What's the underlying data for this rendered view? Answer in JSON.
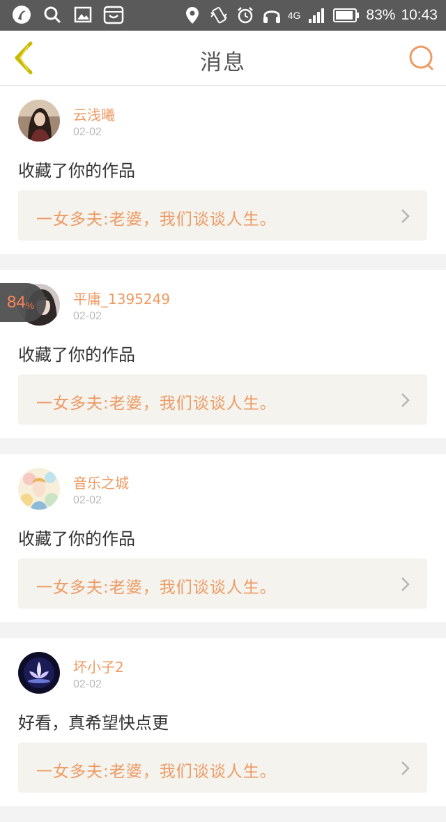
{
  "status_bar": {
    "network": "4G",
    "battery_percent": "83%",
    "time": "10:43"
  },
  "header": {
    "title": "消息"
  },
  "messages": [
    {
      "username": "云浅曦",
      "date": "02-02",
      "text": "收藏了你的作品",
      "work_title": "一女多夫:老婆，我们谈谈人生。",
      "avatar": "avatar-woman-photo"
    },
    {
      "username": "平庸_1395249",
      "date": "02-02",
      "text": "收藏了你的作品",
      "work_title": "一女多夫:老婆，我们谈谈人生。",
      "avatar": "avatar-face-photo"
    },
    {
      "username": "音乐之城",
      "date": "02-02",
      "text": "收藏了你的作品",
      "work_title": "一女多夫:老婆，我们谈谈人生。",
      "avatar": "avatar-anime-illustration"
    },
    {
      "username": "坏小子2",
      "date": "02-02",
      "text": "好看，真希望快点更",
      "work_title": "一女多夫:老婆，我们谈谈人生。",
      "avatar": "avatar-lotus-photo"
    }
  ],
  "floating_badge": {
    "value": "84",
    "unit": "%"
  },
  "colors": {
    "accent_orange": "#ee9a62",
    "back_arrow_yellow": "#c9b800",
    "status_bar_bg": "#5a5a5a"
  }
}
